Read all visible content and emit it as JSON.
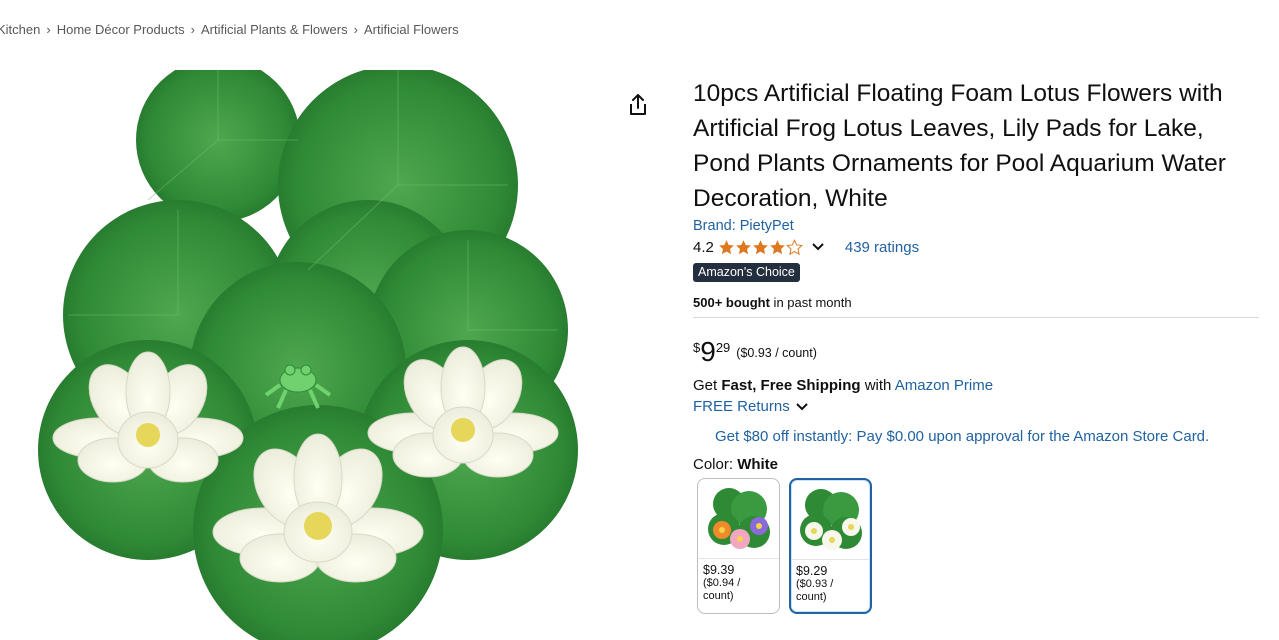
{
  "breadcrumb": {
    "items": [
      "Kitchen",
      "Home Décor Products",
      "Artificial Plants & Flowers",
      "Artificial Flowers"
    ],
    "separator": "›"
  },
  "product": {
    "image_icon": "lotus-lily-pads-product-image",
    "share_icon": "share-icon",
    "title": "10pcs Artificial Floating Foam Lotus Flowers with Artificial Frog Lotus Leaves, Lily Pads for Lake, Pond Plants Ornaments for Pool Aquarium Water Decoration, White",
    "brand_label": "Brand: PietyPet",
    "rating_value": "4.2",
    "star_count": 4.2,
    "ratings_count": "439 ratings",
    "badge": "Amazon's Choice",
    "bought_bold": "500+ bought",
    "bought_rest": " in past month",
    "price_symbol": "$",
    "price_whole": "9",
    "price_fraction": "29",
    "unit_price": "($0.93 / count)",
    "shipping_pre": "Get ",
    "shipping_bold": "Fast, Free Shipping",
    "shipping_mid": " with ",
    "shipping_link": "Amazon Prime",
    "returns": "FREE Returns",
    "store_card": "Get $80 off instantly: Pay $0.00 upon approval for the Amazon Store Card.",
    "color_label": "Color: ",
    "color_value": "White"
  },
  "swatches": [
    {
      "price": "$9.39",
      "unit_line1": "($0.94 /",
      "unit_line2": "count)",
      "selected": false
    },
    {
      "price": "$9.29",
      "unit_line1": "($0.93 /",
      "unit_line2": "count)",
      "selected": true
    }
  ],
  "colors": {
    "link": "#2162a1",
    "star": "#de7921",
    "badge_bg": "#232f3e",
    "leaf": "#3a8f3e"
  }
}
